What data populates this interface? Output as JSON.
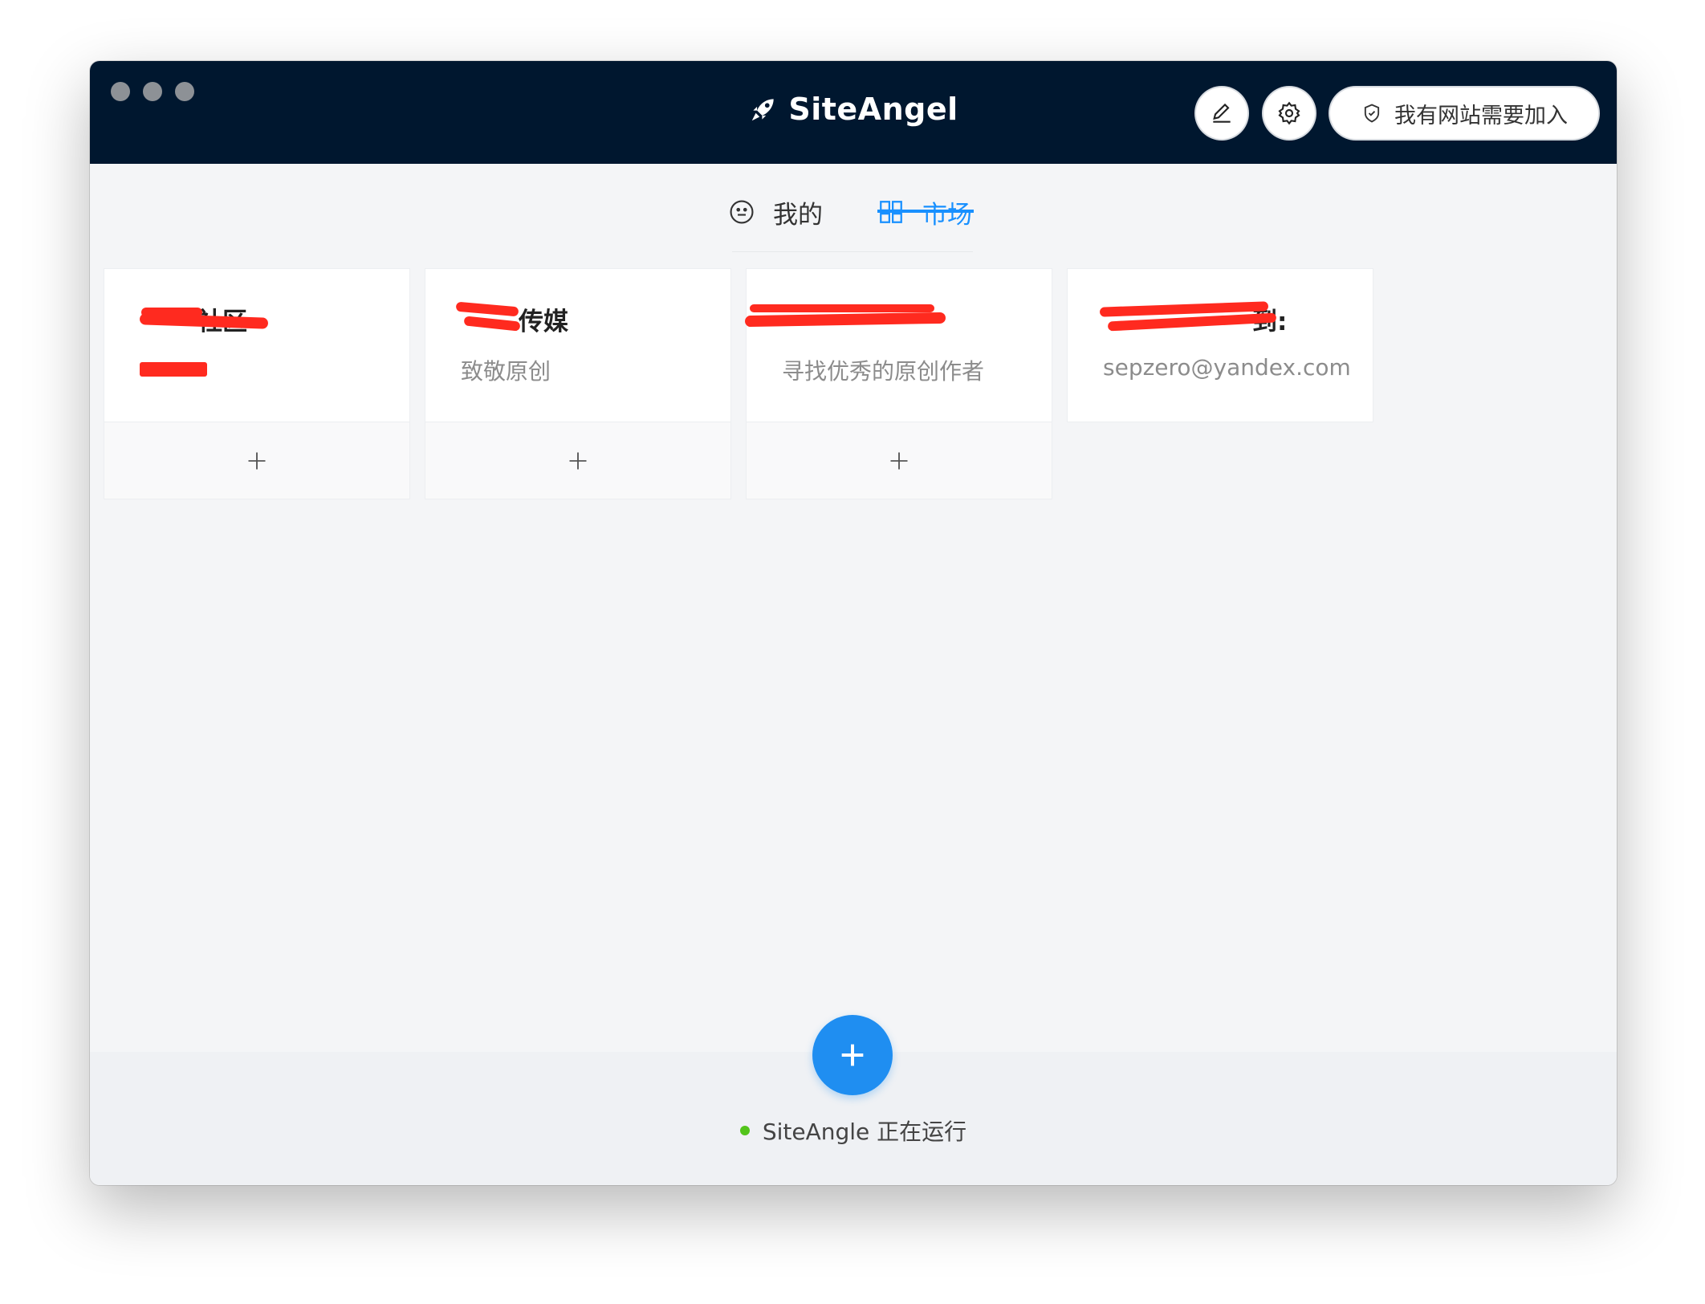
{
  "app": {
    "title": "SiteAngel"
  },
  "header": {
    "join_label": "我有网站需要加入"
  },
  "tabs": [
    {
      "label": "我的",
      "icon": "smile-icon",
      "active": false
    },
    {
      "label": "市场",
      "icon": "grid-icon",
      "active": true
    }
  ],
  "cards": [
    {
      "title": "社区",
      "description": "",
      "has_add": true
    },
    {
      "title": "传媒",
      "description": "致敬原创",
      "has_add": true
    },
    {
      "title": "",
      "description": "寻找优秀的原创作者",
      "has_add": true
    },
    {
      "title": "到:",
      "description": "sepzero@yandex.com",
      "has_add": false
    }
  ],
  "status": {
    "text": "SiteAngle 正在运行",
    "color": "#52c41a"
  },
  "colors": {
    "titlebar": "#00172f",
    "accent": "#1890ff",
    "fab": "#1f8ef1",
    "redaction": "#ff2a1f"
  }
}
